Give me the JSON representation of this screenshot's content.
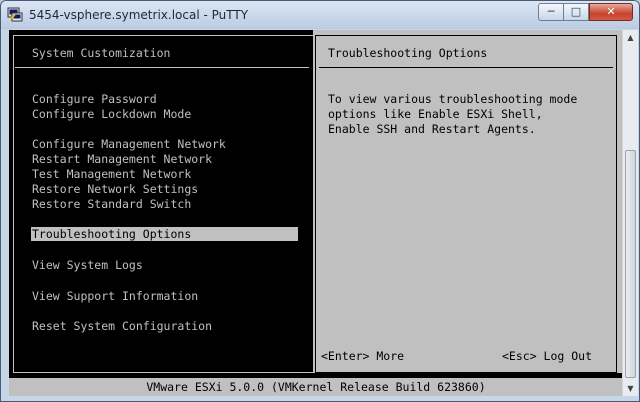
{
  "window": {
    "title": "5454-vsphere.symetrix.local - PuTTY",
    "min_glyph": "─",
    "max_glyph": "□",
    "close_glyph": "✕"
  },
  "colors": {
    "terminal_bg": "#000000",
    "terminal_fg": "#c0c0c0",
    "panel_gray": "#c0c0c0",
    "close_red": "#c7432f"
  },
  "left_panel": {
    "header": "System Customization",
    "items": [
      {
        "label": "Configure Password",
        "selected": false
      },
      {
        "label": "Configure Lockdown Mode",
        "selected": false
      },
      {
        "label": "Configure Management Network",
        "selected": false
      },
      {
        "label": "Restart Management Network",
        "selected": false
      },
      {
        "label": "Test Management Network",
        "selected": false
      },
      {
        "label": "Restore Network Settings",
        "selected": false
      },
      {
        "label": "Restore Standard Switch",
        "selected": false
      },
      {
        "label": "Troubleshooting Options",
        "selected": true
      },
      {
        "label": "View System Logs",
        "selected": false
      },
      {
        "label": "View Support Information",
        "selected": false
      },
      {
        "label": "Reset System Configuration",
        "selected": false
      }
    ]
  },
  "right_panel": {
    "header": "Troubleshooting Options",
    "description": [
      "To view various troubleshooting mode",
      "options like Enable ESXi Shell,",
      "Enable SSH and Restart Agents."
    ],
    "hint_enter": "<Enter> More",
    "hint_esc": "<Esc> Log Out"
  },
  "footer": {
    "text": "VMware ESXi 5.0.0 (VMKernel Release Build 623860)"
  }
}
